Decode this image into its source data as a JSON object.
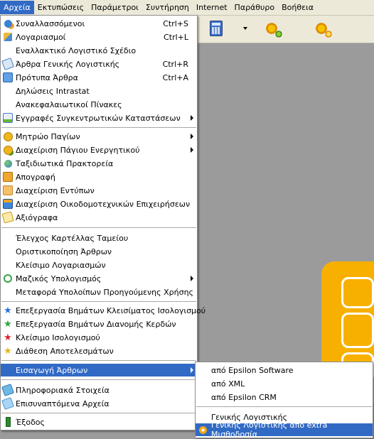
{
  "menubar": {
    "items": [
      "Αρχεία",
      "Εκτυπώσεις",
      "Παράμετροι",
      "Συντήρηση",
      "Internet",
      "Παράθυρο",
      "Βοήθεια"
    ]
  },
  "colors": {
    "highlight": "#316ac5",
    "menu_bg": "#ffffff",
    "workspace": "#9b9b9b",
    "accent": "#f7b000"
  },
  "toolbar": {
    "icons": [
      "calculator-icon",
      "dropdown-arrow-icon",
      "gears-green-icon",
      "gears-orange-icon"
    ]
  },
  "file_menu": {
    "items": [
      {
        "label": "Συναλλασσόμενοι",
        "shortcut": "Ctrl+S",
        "icon": "people-icon"
      },
      {
        "label": "Λογαριασμοί",
        "shortcut": "Ctrl+L",
        "icon": "accounts-icon"
      },
      {
        "label": "Εναλλακτικό Λογιστικό Σχέδιο",
        "shortcut": "",
        "icon": ""
      },
      {
        "label": "Άρθρα Γενικής Λογιστικής",
        "shortcut": "Ctrl+R",
        "icon": "ledger-icon"
      },
      {
        "label": "Πρότυπα Άρθρα",
        "shortcut": "Ctrl+A",
        "icon": "template-icon"
      },
      {
        "label": "Δηλώσεις Intrastat",
        "shortcut": "",
        "icon": ""
      },
      {
        "label": "Ανακεφαλαιωτικοί Πίνακες",
        "shortcut": "",
        "icon": ""
      },
      {
        "label": "Εγγραφές Συγκεντρωτικών Καταστάσεων",
        "shortcut": "",
        "icon": "records-icon",
        "submenu": true
      },
      {
        "label": "Μητρώο Παγίων",
        "shortcut": "",
        "icon": "assets-registry-icon",
        "submenu": true
      },
      {
        "label": "Διαχείριση Πάγιου Ενεργητικού",
        "shortcut": "",
        "icon": "assets-management-icon",
        "submenu": true
      },
      {
        "label": "Ταξιδιωτικά Πρακτορεία",
        "shortcut": "",
        "icon": "globe-icon"
      },
      {
        "label": "Απογραφή",
        "shortcut": "",
        "icon": "inventory-icon"
      },
      {
        "label": "Διαχείριση Εντύπων",
        "shortcut": "",
        "icon": "forms-icon"
      },
      {
        "label": "Διαχείριση Οικοδομοτεχνικών Επιχειρήσεων",
        "shortcut": "",
        "icon": "construction-icon"
      },
      {
        "label": "Αξιόγραφα",
        "shortcut": "",
        "icon": "securities-icon"
      },
      {
        "label": "Έλεγχος Καρτέλλας Ταμείου",
        "shortcut": "",
        "icon": ""
      },
      {
        "label": "Οριστικοποίηση Άρθρων",
        "shortcut": "",
        "icon": ""
      },
      {
        "label": "Κλείσιμο Λογαριασμών",
        "shortcut": "",
        "icon": ""
      },
      {
        "label": "Μαζικός Υπολογισμός",
        "shortcut": "",
        "icon": "calc-refresh-icon",
        "submenu": true
      },
      {
        "label": "Μεταφορά Υπολοίπων Προηγούμενης Χρήσης",
        "shortcut": "",
        "icon": ""
      },
      {
        "label": "Επεξεργασία Βημάτων Κλεισίματος Ισολογισμού",
        "shortcut": "",
        "icon": "blue-star-icon"
      },
      {
        "label": "Επεξεργασία Βημάτων Διανομής Κερδών",
        "shortcut": "",
        "icon": "green-star-icon"
      },
      {
        "label": "Κλείσιμο Ισολογισμού",
        "shortcut": "",
        "icon": "red-star-icon"
      },
      {
        "label": "Διάθεση Αποτελεσμάτων",
        "shortcut": "",
        "icon": "yellow-star-icon"
      },
      {
        "label": "Εισαγωγή Άρθρων",
        "shortcut": "",
        "icon": "",
        "submenu": true,
        "highlighted": true
      },
      {
        "label": "Πληροφοριακά Στοιχεία",
        "shortcut": "",
        "icon": "info-icon"
      },
      {
        "label": "Επισυναπτόμενα Αρχεία",
        "shortcut": "",
        "icon": "attachments-icon"
      },
      {
        "label": "Έξοδος",
        "shortcut": "",
        "icon": "exit-icon"
      }
    ]
  },
  "import_submenu": {
    "items": [
      {
        "label": "από Epsilon Software",
        "icon": ""
      },
      {
        "label": "από XML",
        "icon": ""
      },
      {
        "label": "από Epsilon CRM",
        "icon": ""
      },
      {
        "label": "Γενικής Λογιστικής",
        "icon": ""
      },
      {
        "label": "Γενικής Λογιστικής από extra Μισθοδοσία",
        "icon": "gear-icon",
        "highlighted": true
      }
    ]
  }
}
